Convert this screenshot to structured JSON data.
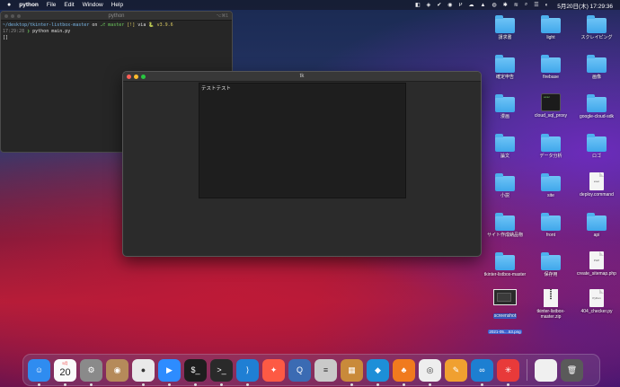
{
  "menubar": {
    "apple_icon": "apple-icon",
    "app_name": "python",
    "menus": [
      "File",
      "Edit",
      "Window",
      "Help"
    ],
    "clock": "5月20日(木)  17:29:36"
  },
  "terminal": {
    "title": "python",
    "shortcut": "⌥⌘1",
    "prompt_path": "~/desktop/tkinter-listbox-master",
    "prompt_on": "on",
    "branch_icon": "git-branch-icon",
    "branch": "master",
    "status": "[!]",
    "via": "via",
    "python_icon": "python-icon",
    "python_version": "v3.9.6",
    "time": "17:29:28",
    "prompt_char": "❯",
    "command": "python main.py",
    "cursor_line": "[]"
  },
  "tk_window": {
    "title": "tk",
    "listbox_items": [
      "テストテスト"
    ]
  },
  "desktop_icons": [
    {
      "label": "請求書",
      "kind": "folder"
    },
    {
      "label": "light",
      "kind": "folder"
    },
    {
      "label": "スクレイピング",
      "kind": "folder"
    },
    {
      "label": "確定申告",
      "kind": "folder"
    },
    {
      "label": "firebase",
      "kind": "folder"
    },
    {
      "label": "画像",
      "kind": "folder"
    },
    {
      "label": "漫画",
      "kind": "folder"
    },
    {
      "label": "cloud_sql_proxy",
      "kind": "exec"
    },
    {
      "label": "google-cloud-sdk",
      "kind": "folder"
    },
    {
      "label": "論文",
      "kind": "folder"
    },
    {
      "label": "データ分析",
      "kind": "folder"
    },
    {
      "label": "ロゴ",
      "kind": "folder"
    },
    {
      "label": "小説",
      "kind": "folder"
    },
    {
      "label": "site",
      "kind": "folder"
    },
    {
      "label": "deploy.command",
      "kind": "file",
      "file_text": "exec"
    },
    {
      "label": "サイト作成納品物",
      "kind": "folder"
    },
    {
      "label": "front",
      "kind": "folder"
    },
    {
      "label": "api",
      "kind": "folder"
    },
    {
      "label": "tkinter-listbox-master",
      "kind": "folder"
    },
    {
      "label": "保存用",
      "kind": "folder"
    },
    {
      "label": "create_sitemap.php",
      "kind": "file",
      "file_text": "PHP"
    },
    {
      "label": "screenshot",
      "sub": "2021-05....53.png",
      "kind": "shot"
    },
    {
      "label": "tkinter-listbox-master.zip",
      "kind": "zip"
    },
    {
      "label": "404_checker.py",
      "kind": "file",
      "file_text": "Python"
    }
  ],
  "dock": [
    {
      "name": "finder",
      "color": "#2f8cf0",
      "glyph": "☺"
    },
    {
      "name": "calendar",
      "color": "#fafafa",
      "month": "5月",
      "day": "20"
    },
    {
      "name": "system-preferences",
      "color": "#8a8a8a",
      "glyph": "⚙"
    },
    {
      "name": "contacts",
      "color": "#b58a5a",
      "glyph": "◉"
    },
    {
      "name": "chrome",
      "color": "#e9e9e9",
      "glyph": "●"
    },
    {
      "name": "zoom",
      "color": "#2d8cff",
      "glyph": "▶"
    },
    {
      "name": "iterm",
      "color": "#1e1e1e",
      "glyph": "$_"
    },
    {
      "name": "terminal",
      "color": "#2a2a2a",
      "glyph": ">_"
    },
    {
      "name": "vscode",
      "color": "#1f7fd4",
      "glyph": "⟩"
    },
    {
      "name": "safari",
      "color": "#fd5a44",
      "glyph": "✦"
    },
    {
      "name": "quicktime",
      "color": "#3b6bb3",
      "glyph": "Q"
    },
    {
      "name": "sequel-pro",
      "color": "#c9c9c9",
      "glyph": "≡"
    },
    {
      "name": "archive",
      "color": "#c98a3a",
      "glyph": "▦"
    },
    {
      "name": "docker",
      "color": "#1d8fd8",
      "glyph": "◆"
    },
    {
      "name": "sourcetree",
      "color": "#f07a1e",
      "glyph": "♣"
    },
    {
      "name": "sequel",
      "color": "#eeeeee",
      "glyph": "◎"
    },
    {
      "name": "pages",
      "color": "#f0a030",
      "glyph": "✎"
    },
    {
      "name": "arduino",
      "color": "#1d7fd1",
      "glyph": "∞"
    },
    {
      "name": "clock",
      "color": "#e83a3a",
      "glyph": "✳"
    },
    {
      "name": "document",
      "color": "#f0f0f0",
      "glyph": ""
    },
    {
      "name": "trash",
      "color": "#5a5a5a",
      "glyph": "🗑"
    }
  ]
}
